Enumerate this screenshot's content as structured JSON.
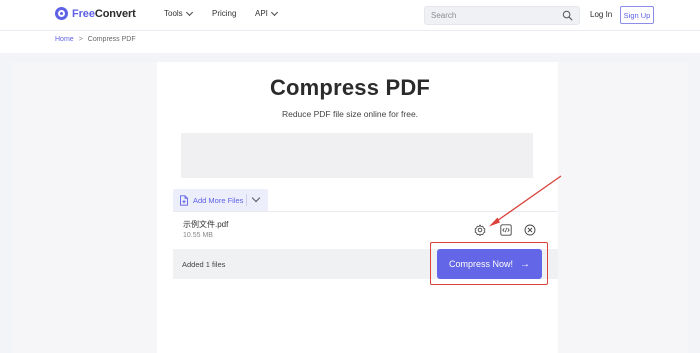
{
  "header": {
    "logo_part1": "Free",
    "logo_part2": "Convert",
    "nav": {
      "tools": "Tools",
      "pricing": "Pricing",
      "api": "API"
    },
    "search_placeholder": "Search",
    "login": "Log In",
    "signup": "Sign Up"
  },
  "breadcrumb": {
    "home": "Home",
    "separator": ">",
    "current": "Compress PDF"
  },
  "main": {
    "title": "Compress PDF",
    "subtitle": "Reduce PDF file size online for free."
  },
  "uploader": {
    "add_more_label": "Add More Files",
    "file": {
      "name": "示例文件.pdf",
      "size": "10.55 MB"
    },
    "added_count": "Added 1 files",
    "compress_button": "Compress Now!",
    "compress_arrow": "→"
  },
  "colors": {
    "brand": "#5f61e6",
    "button": "#6366e6",
    "annotation": "#d9433a"
  },
  "icons": [
    "logo-icon",
    "search-icon",
    "file-icon",
    "chevron-down-icon",
    "gear-icon",
    "code-icon",
    "close-icon",
    "arrow-right-icon"
  ]
}
